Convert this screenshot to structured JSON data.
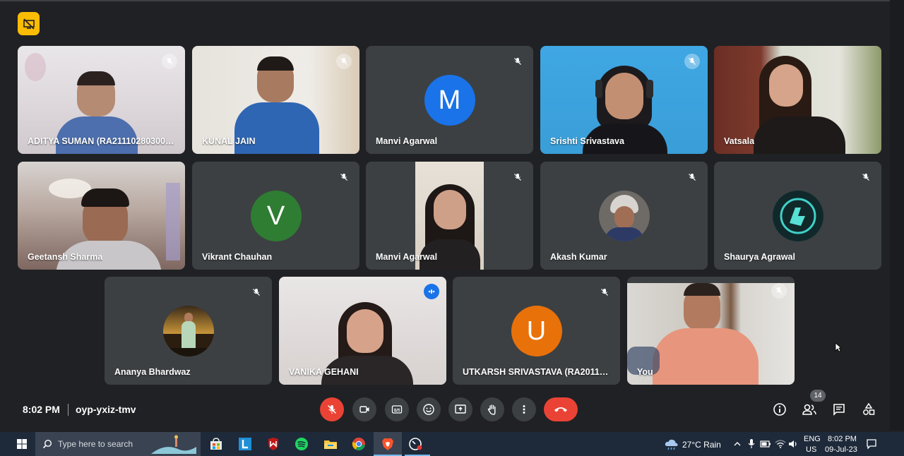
{
  "meeting": {
    "time": "8:02 PM",
    "code": "oyp-yxiz-tmv",
    "participant_count": "14"
  },
  "participants": [
    {
      "name": "ADITYA SUMAN (RA2111028030000...",
      "muted": true,
      "video": true
    },
    {
      "name": "KUNAL JAIN",
      "muted": true,
      "video": true
    },
    {
      "name": "Manvi Agarwal",
      "muted": true,
      "video": false,
      "initial": "M",
      "color": "#1a73e8"
    },
    {
      "name": "Srishti Srivastava",
      "muted": true,
      "video": true
    },
    {
      "name": "Vatsala",
      "muted": false,
      "video": true
    },
    {
      "name": "Geetansh Sharma",
      "muted": false,
      "video": true
    },
    {
      "name": "Vikrant Chauhan",
      "muted": true,
      "video": false,
      "initial": "V",
      "color": "#2e7d32"
    },
    {
      "name": "Manvi Agarwal",
      "muted": true,
      "video": true
    },
    {
      "name": "Akash Kumar",
      "muted": true,
      "video": false,
      "photo_avatar": true
    },
    {
      "name": "Shaurya Agrawal",
      "muted": true,
      "video": false,
      "photo_avatar": true
    },
    {
      "name": "Ananya Bhardwaz",
      "muted": true,
      "video": false,
      "photo_avatar": true
    },
    {
      "name": "VANIKA GEHANI",
      "muted": false,
      "video": true,
      "speaking": true
    },
    {
      "name": "UTKARSH SRIVASTAVA (RA201102...",
      "muted": true,
      "video": false,
      "initial": "U",
      "color": "#e8710a"
    },
    {
      "name": "You",
      "muted": true,
      "video": true
    }
  ],
  "controls": [
    {
      "name": "mic-off-button"
    },
    {
      "name": "camera-button"
    },
    {
      "name": "captions-button"
    },
    {
      "name": "emoji-button"
    },
    {
      "name": "present-button"
    },
    {
      "name": "raise-hand-button"
    },
    {
      "name": "more-options-button"
    },
    {
      "name": "leave-call-button"
    }
  ],
  "taskbar": {
    "search_placeholder": "Type here to search",
    "weather": "27°C  Rain",
    "lang_top": "ENG",
    "lang_bottom": "US",
    "clock_time": "8:02 PM",
    "clock_date": "09-Jul-23"
  },
  "colors": {
    "background": "#202124",
    "tile": "#3c4043",
    "accent_red": "#ea4335",
    "accent_blue": "#1a73e8",
    "badge_yellow": "#fbbc04"
  }
}
